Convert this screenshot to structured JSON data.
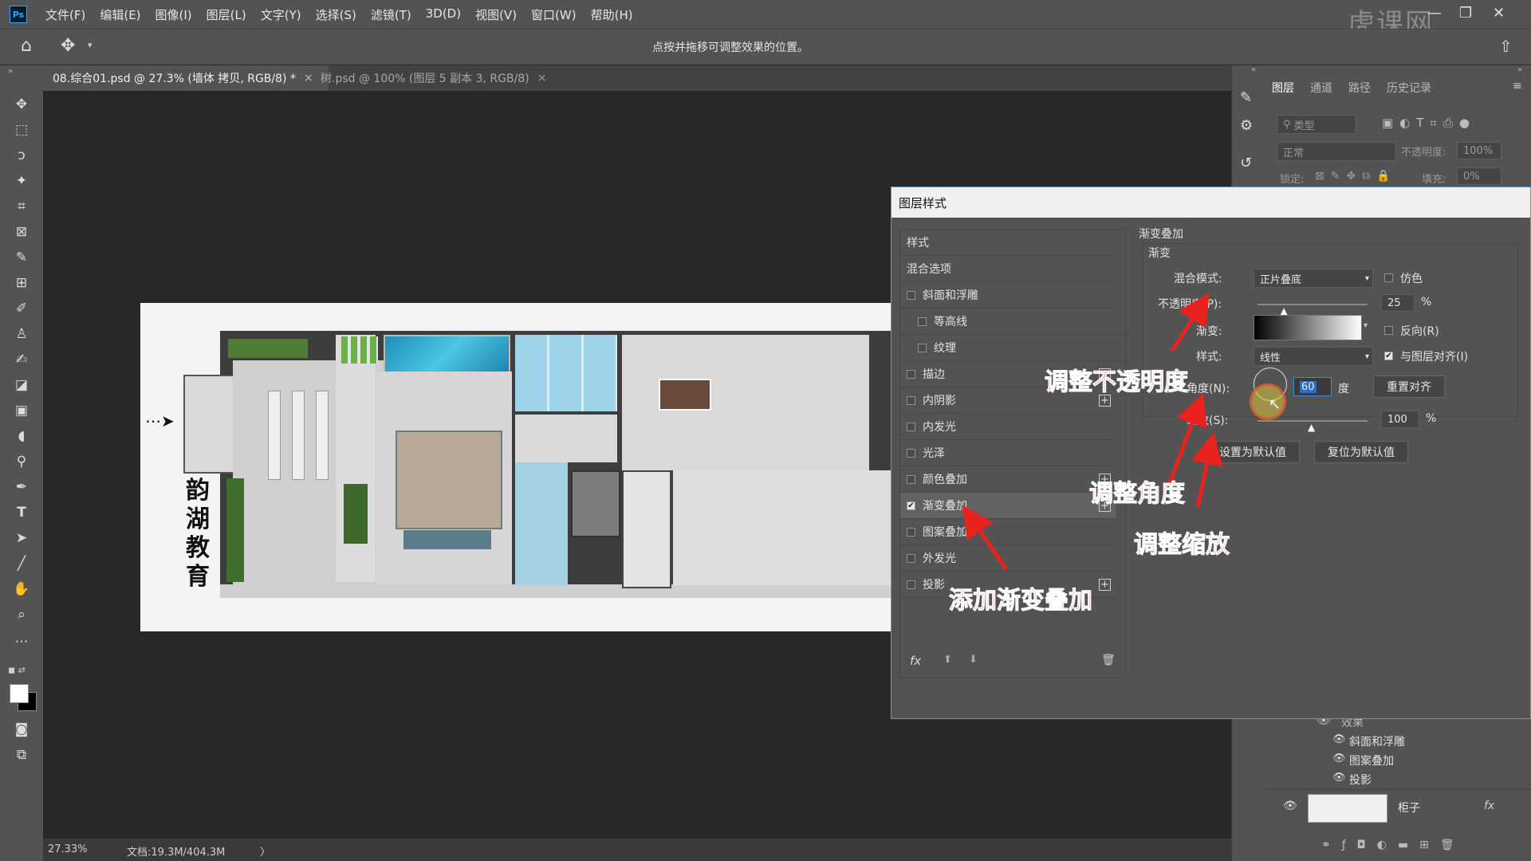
{
  "menubar": {
    "logo": "Ps",
    "items": [
      "文件(F)",
      "编辑(E)",
      "图像(I)",
      "图层(L)",
      "文字(Y)",
      "选择(S)",
      "滤镜(T)",
      "3D(D)",
      "视图(V)",
      "窗口(W)",
      "帮助(H)"
    ],
    "watermark": "虎课网"
  },
  "options_bar": {
    "hint": "点按并拖移可调整效果的位置。"
  },
  "tabs": [
    {
      "label": "08.综合01.psd @ 27.3% (墙体 拷贝, RGB/8) *",
      "close": "×"
    },
    {
      "label": "树.psd @ 100% (图层 5 副本 3, RGB/8)",
      "close": "×"
    }
  ],
  "status": {
    "zoom": "27.33%",
    "doc": "文档:19.3M/404.3M",
    "arrow": "〉"
  },
  "canvas": {
    "plan_title": [
      "韵",
      "湖",
      "教",
      "育"
    ]
  },
  "panel_tabs": [
    "图层",
    "通道",
    "路径",
    "历史记录"
  ],
  "layers": {
    "filter_placeholder": "类型",
    "blend": "正常",
    "opacity_label": "不透明度:",
    "opacity": "100%",
    "lock_label": "锁定:",
    "fill_label": "填充:",
    "fill": "0%",
    "effects_label": "效果",
    "effects": [
      "斜面和浮雕",
      "图案叠加",
      "投影"
    ],
    "layer_name": "柜子",
    "layer_next": "效果"
  },
  "dialog": {
    "title": "图层样式",
    "styles_header": "样式",
    "blend_options": "混合选项",
    "styles": [
      {
        "label": "斜面和浮雕",
        "checked": false,
        "indent": false,
        "plus": false
      },
      {
        "label": "等高线",
        "checked": false,
        "indent": true,
        "plus": false
      },
      {
        "label": "纹理",
        "checked": false,
        "indent": true,
        "plus": false
      },
      {
        "label": "描边",
        "checked": false,
        "indent": false,
        "plus": true
      },
      {
        "label": "内阴影",
        "checked": false,
        "indent": false,
        "plus": true
      },
      {
        "label": "内发光",
        "checked": false,
        "indent": false,
        "plus": false
      },
      {
        "label": "光泽",
        "checked": false,
        "indent": false,
        "plus": false
      },
      {
        "label": "颜色叠加",
        "checked": false,
        "indent": false,
        "plus": true
      },
      {
        "label": "渐变叠加",
        "checked": true,
        "indent": false,
        "plus": true
      },
      {
        "label": "图案叠加",
        "checked": false,
        "indent": false,
        "plus": false
      },
      {
        "label": "外发光",
        "checked": false,
        "indent": false,
        "plus": false
      },
      {
        "label": "投影",
        "checked": false,
        "indent": false,
        "plus": true
      }
    ],
    "fx_label": "fx",
    "section_title": "渐变叠加",
    "group_title": "渐变",
    "blend_mode_label": "混合模式:",
    "blend_mode": "正片叠底",
    "dither_label": "仿色",
    "opacity_label": "不透明度(P):",
    "opacity_value": "25",
    "opacity_fraction": 0.25,
    "percent": "%",
    "gradient_label": "渐变:",
    "reverse_label": "反向(R)",
    "style_label": "样式:",
    "style_value": "线性",
    "align_label": "与图层对齐(I)",
    "angle_label": "角度(N):",
    "angle_value": "60",
    "degree_unit": "度",
    "reset_align": "重置对齐",
    "scale_label": "缩放(S):",
    "scale_value": "100",
    "scale_fraction": 0.5,
    "set_default": "设置为默认值",
    "reset_default": "复位为默认值"
  },
  "annotations": {
    "opacity": "调整不透明度",
    "angle": "调整角度",
    "scale": "调整缩放",
    "add": "添加渐变叠加"
  },
  "colors": {
    "annotation": "#e8231d",
    "accent": "#31a8ff"
  }
}
